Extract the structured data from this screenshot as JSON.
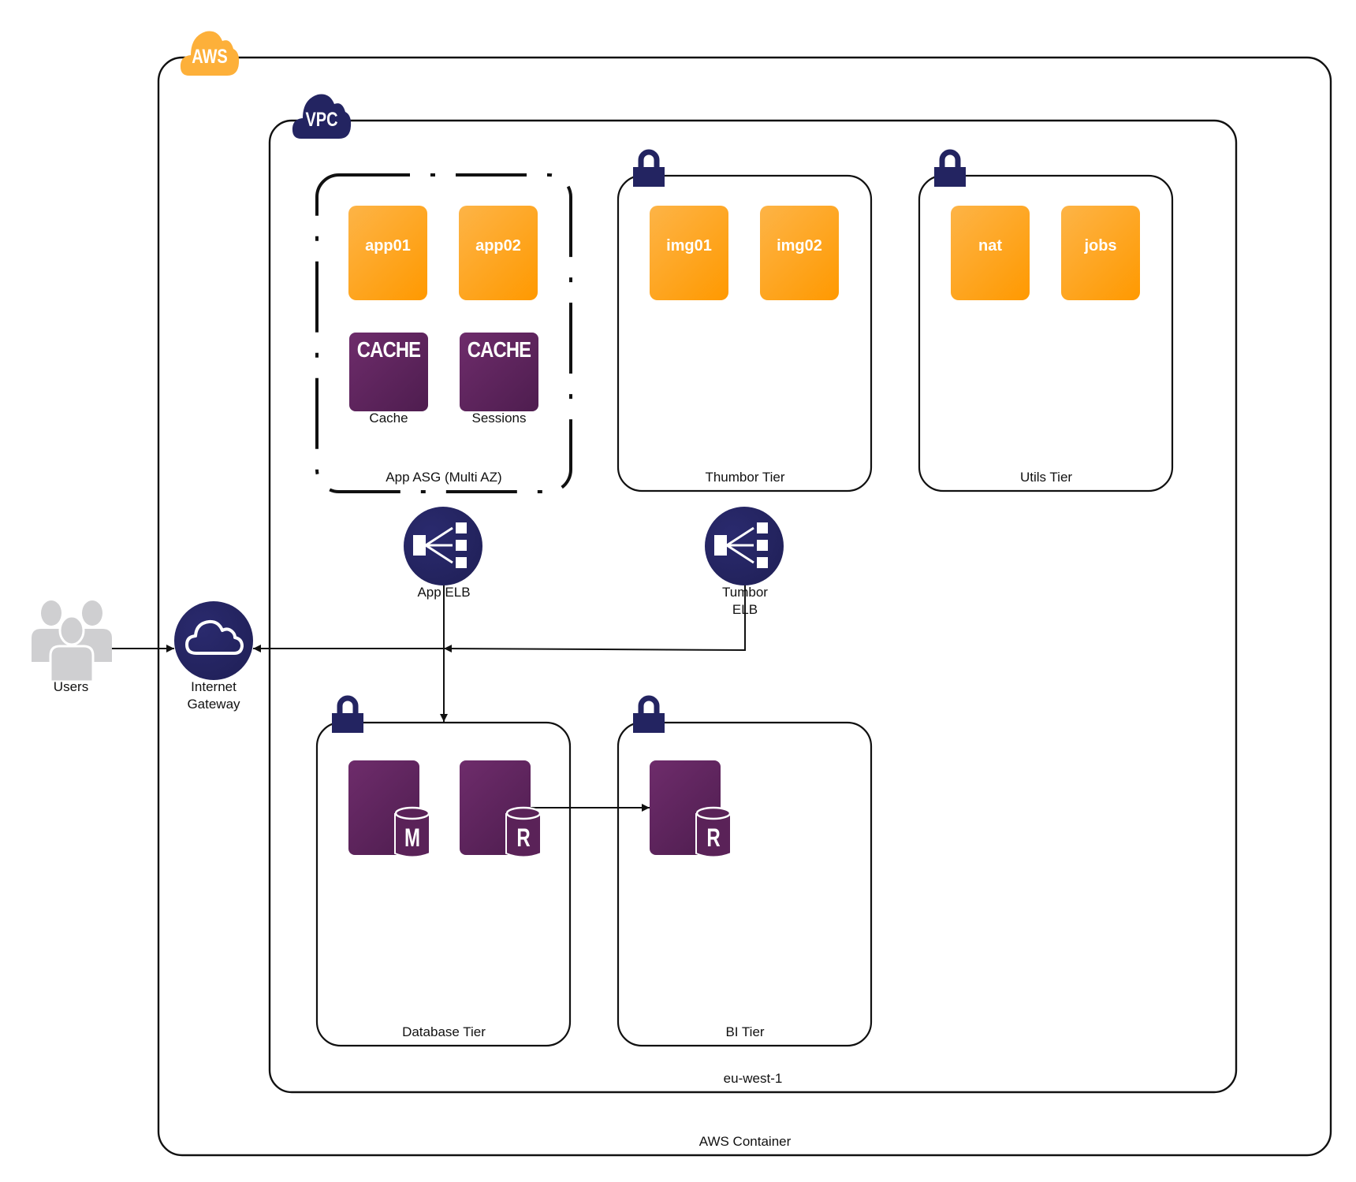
{
  "containers": {
    "aws": {
      "badge": "AWS",
      "label": "AWS Container",
      "badge_color": "#FDB03A"
    },
    "vpc": {
      "badge": "VPC",
      "label": "eu-west-1",
      "badge_color": "#232461"
    },
    "app_asg": {
      "label": "App ASG (Multi AZ)"
    },
    "thumbor_tier": {
      "label": "Thumbor Tier"
    },
    "utils_tier": {
      "label": "Utils Tier"
    },
    "database_tier": {
      "label": "Database Tier"
    },
    "bi_tier": {
      "label": "BI Tier"
    }
  },
  "instances": {
    "app01": "app01",
    "app02": "app02",
    "img01": "img01",
    "img02": "img02",
    "nat": "nat",
    "jobs": "jobs"
  },
  "caches": [
    {
      "badge": "CACHE",
      "label": "Cache"
    },
    {
      "badge": "CACHE",
      "label": "Sessions"
    }
  ],
  "databases": [
    {
      "badge": "M",
      "role": "master"
    },
    {
      "badge": "R",
      "role": "replica"
    },
    {
      "badge": "R",
      "role": "replica"
    }
  ],
  "nodes": {
    "users": "Users",
    "internet_gateway_line1": "Internet",
    "internet_gateway_line2": "Gateway",
    "app_elb": "App ELB",
    "tumbor_elb_line1": "Tumbor",
    "tumbor_elb_line2": "ELB"
  },
  "colors": {
    "ec2_orange": "#FF9900",
    "db_purple": "#5E2458",
    "navy": "#232461",
    "users_gray": "#CFCFD1"
  }
}
